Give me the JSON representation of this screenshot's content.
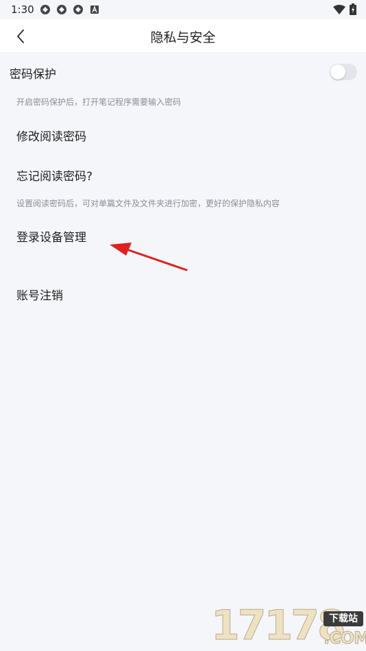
{
  "status_bar": {
    "time": "1:30",
    "icons": [
      "sync-icon",
      "sync-icon",
      "sync-icon",
      "a-icon"
    ],
    "right_icons": [
      "wifi-icon",
      "battery-icon"
    ]
  },
  "header": {
    "title": "隐私与安全",
    "back_icon": "chevron-left-icon"
  },
  "password_protection": {
    "label": "密码保护",
    "hint": "开启密码保护后，打开笔记程序需要输入密码",
    "enabled": false
  },
  "change_read_password": {
    "label": "修改阅读密码"
  },
  "forgot_read_password": {
    "label": "忘记阅读密码?",
    "hint": "设置阅读密码后，可对单篇文件及文件夹进行加密，更好的保护隐私内容"
  },
  "device_management": {
    "label": "登录设备管理"
  },
  "account_cancel": {
    "label": "账号注销"
  },
  "watermark": {
    "number": "17178",
    "badge": "下载站",
    "domain": ".COM"
  },
  "colors": {
    "background": "#f5f6fa",
    "header": "#ffffff",
    "hint": "#8a8e96",
    "toggle_off": "#e3e5ea",
    "arrow": "#e0201b"
  }
}
